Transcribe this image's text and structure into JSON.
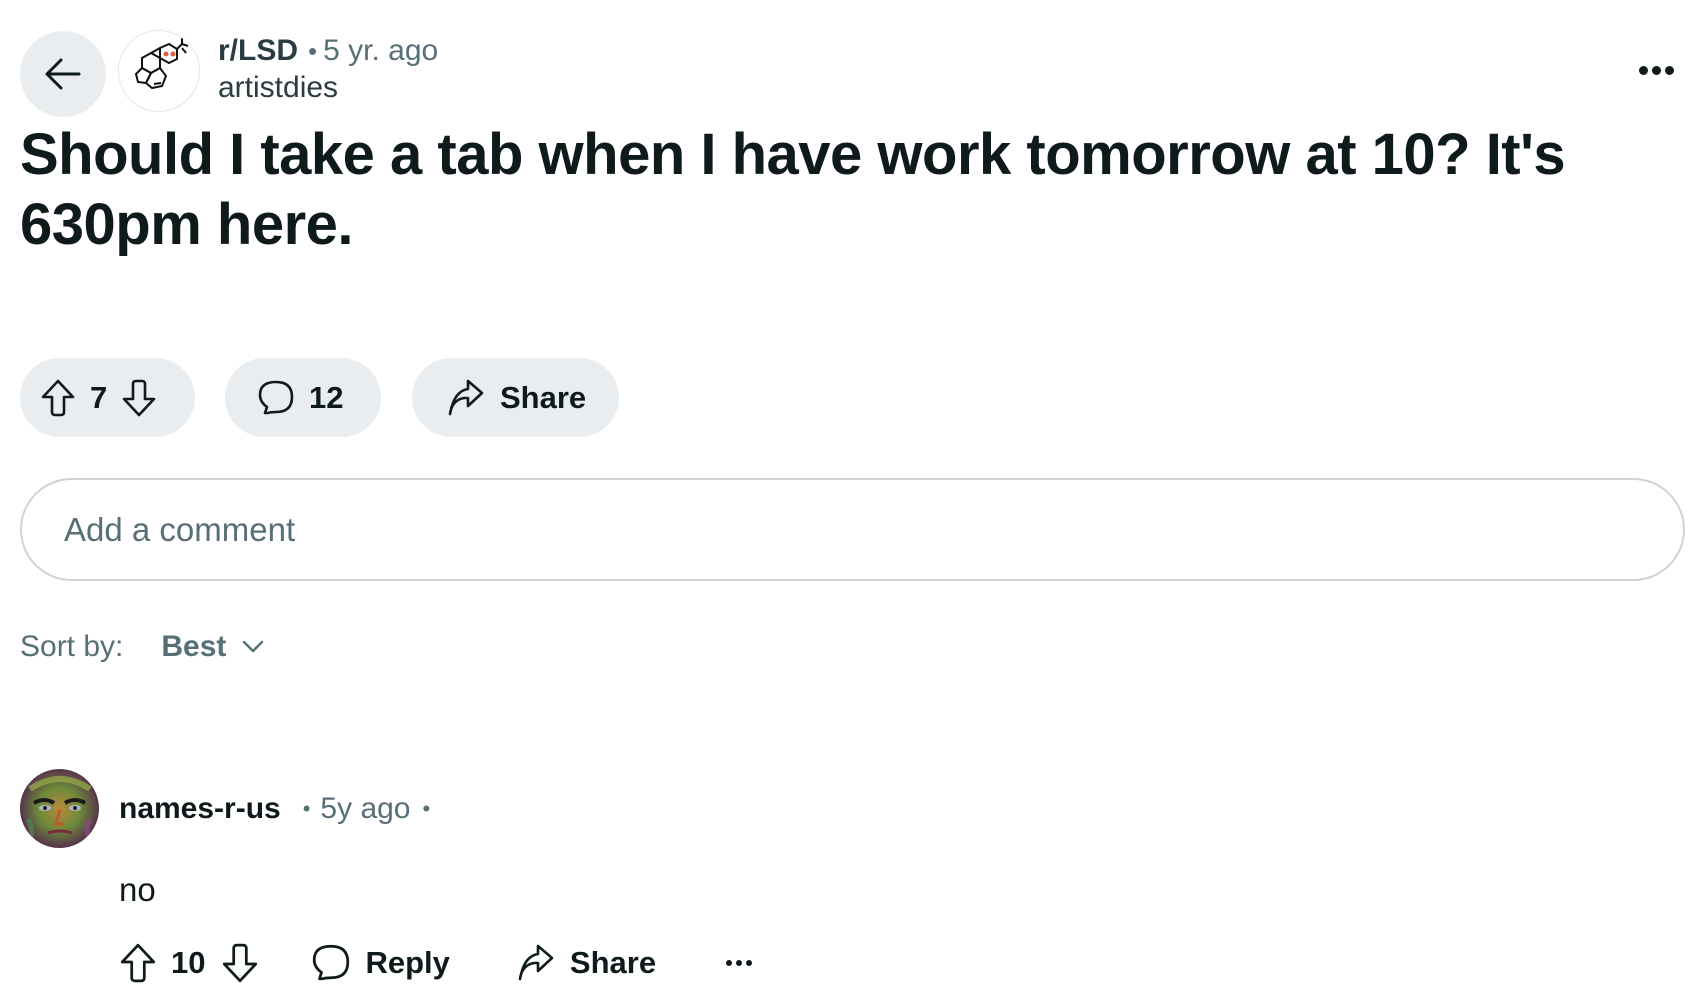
{
  "post": {
    "subreddit": "r/LSD",
    "separator": "•",
    "time_ago": "5 yr. ago",
    "author": "artistdies",
    "title": "Should I take a tab when I have work tomorrow at 10? It's 630pm here.",
    "score": "7",
    "comment_count": "12",
    "share_label": "Share"
  },
  "comment_box": {
    "placeholder": "Add a comment"
  },
  "sort": {
    "label": "Sort by:",
    "value": "Best"
  },
  "comments": [
    {
      "author": "names-r-us",
      "separator": "•",
      "time_ago": "5y ago",
      "body": "no",
      "score": "10",
      "reply_label": "Reply",
      "share_label": "Share"
    }
  ],
  "icons": {
    "back": "arrow-left",
    "more": "ellipsis-horizontal",
    "upvote": "arrow-up-outline",
    "downvote": "arrow-down-outline",
    "comment": "speech-bubble",
    "share": "share-arrow",
    "sort_chevron": "chevron-down"
  },
  "colors": {
    "pill_bg": "#eaedef",
    "text_primary": "#0f1a1c",
    "text_secondary": "#576f76",
    "input_border": "#cfd3d6",
    "avatar_accent": "#d9603b"
  }
}
